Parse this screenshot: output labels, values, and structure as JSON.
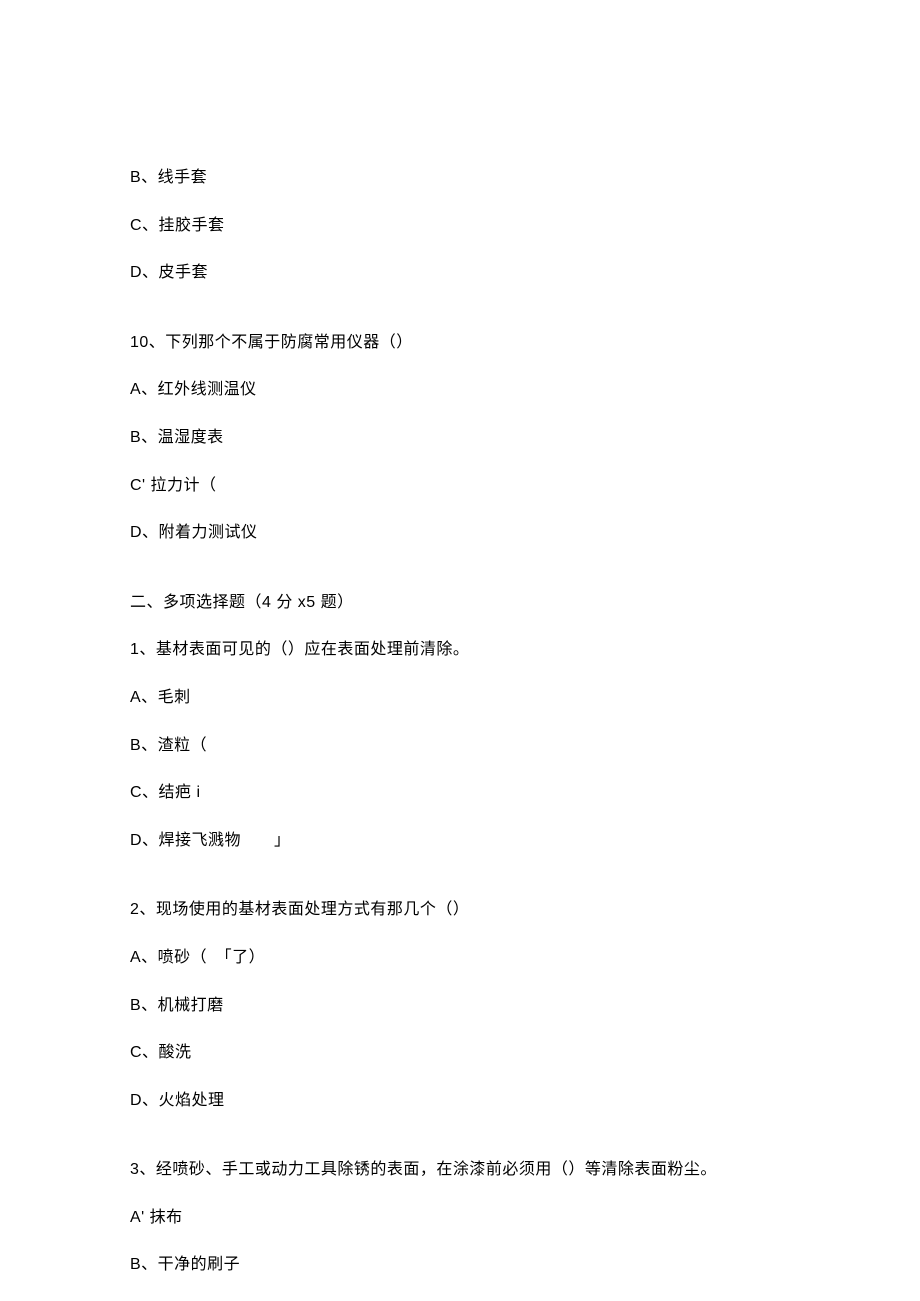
{
  "lines": {
    "q9_optB": "B、线手套",
    "q9_optC": "C、挂胶手套",
    "q9_optD": "D、皮手套",
    "q10_stem": "10、下列那个不属于防腐常用仪器（）",
    "q10_optA": "A、红外线测温仪",
    "q10_optB": "B、温湿度表",
    "q10_optC": "C' 拉力计（",
    "q10_optD": "D、附着力测试仪",
    "section2_title": "二、多项选择题（4 分 x5 题）",
    "s2q1_stem": "1、基材表面可见的（）应在表面处理前清除。",
    "s2q1_optA": "A、毛刺",
    "s2q1_optB": "B、渣粒（",
    "s2q1_optC": "C、结疤 i",
    "s2q1_optD": "D、焊接飞溅物　　」",
    "s2q2_stem": "2、现场使用的基材表面处理方式有那几个（）",
    "s2q2_optA": "A、喷砂（　「了）",
    "s2q2_optB": "B、机械打磨",
    "s2q2_optC": "C、酸洗",
    "s2q2_optD": "D、火焰处理",
    "s2q3_stem": "3、经喷砂、手工或动力工具除锈的表面，在涂漆前必须用（）等清除表面粉尘。",
    "s2q3_optA": "A' 抹布",
    "s2q3_optB": "B、干净的刷子"
  }
}
